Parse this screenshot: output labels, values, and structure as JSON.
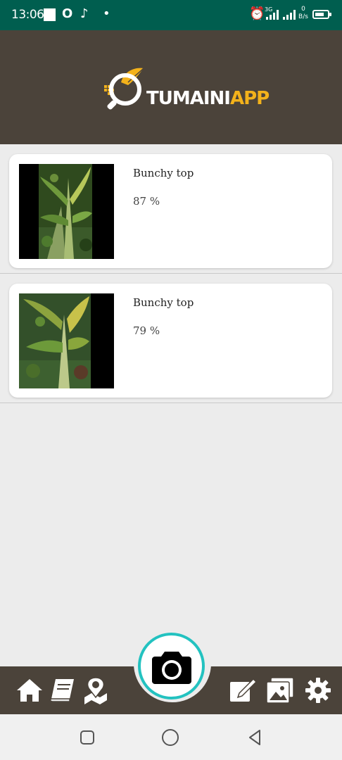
{
  "status_bar": {
    "time": "13:06",
    "network_label": "3G",
    "speed_label": "0 B/s",
    "icons": [
      "opera-icon",
      "tiktok-icon",
      "dot-icon",
      "alarm-icon",
      "signal-icon",
      "signal-icon",
      "battery-icon"
    ],
    "battery_level": 0.75
  },
  "header": {
    "logo_text_white": "TUMAINI",
    "logo_text_yellow": "APP",
    "brand_color": "#f3b21b",
    "background": "#4b433a"
  },
  "results": [
    {
      "disease": "Bunchy top",
      "confidence": "87 %"
    },
    {
      "disease": "Bunchy top",
      "confidence": "79 %"
    }
  ],
  "bottom_nav": {
    "items": [
      "home-icon",
      "book-icon",
      "map-pin-icon",
      "camera-icon",
      "edit-icon",
      "gallery-icon",
      "settings-icon"
    ],
    "accent": "#23c2c0"
  },
  "system_nav": [
    "recents-icon",
    "home-circle-icon",
    "back-icon"
  ]
}
